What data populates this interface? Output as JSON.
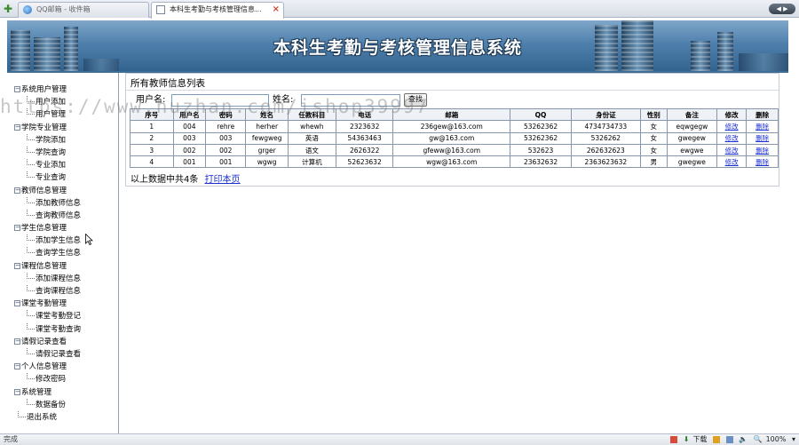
{
  "browser": {
    "tabs": [
      {
        "label": "QQ邮箱 - 收件箱",
        "active": false
      },
      {
        "label": "本科生考勤与考核管理信息...",
        "active": true
      }
    ],
    "new_tab_icon": "plus-icon",
    "status_text": "完成",
    "status_download": "下载",
    "zoom": "100%"
  },
  "header": {
    "title": "本科生考勤与考核管理信息系统"
  },
  "sidebar": {
    "groups": [
      {
        "label": "系统用户管理",
        "items": [
          "用户添加",
          "用户管理"
        ]
      },
      {
        "label": "学院专业管理",
        "items": [
          "学院添加",
          "学院查询",
          "专业添加",
          "专业查询"
        ]
      },
      {
        "label": "教师信息管理",
        "items": [
          "添加教师信息",
          "查询教师信息"
        ]
      },
      {
        "label": "学生信息管理",
        "items": [
          "添加学生信息",
          "查询学生信息"
        ]
      },
      {
        "label": "课程信息管理",
        "items": [
          "添加课程信息",
          "查询课程信息"
        ]
      },
      {
        "label": "课堂考勤管理",
        "items": [
          "课堂考勤登记",
          "课堂考勤查询"
        ]
      },
      {
        "label": "请假记录查看",
        "items": [
          "请假记录查看"
        ]
      },
      {
        "label": "个人信息管理",
        "items": [
          "修改密码"
        ]
      },
      {
        "label": "系统管理",
        "items": [
          "数据备份"
        ]
      }
    ],
    "logout": "退出系统"
  },
  "main": {
    "title": "所有教师信息列表",
    "search": {
      "username_label": "用户名:",
      "username_value": "",
      "name_label": "姓名:",
      "name_value": "",
      "button": "查找"
    },
    "table": {
      "headers": [
        "序号",
        "用户名",
        "密码",
        "姓名",
        "任教科目",
        "电话",
        "邮箱",
        "QQ",
        "身份证",
        "性别",
        "备注",
        "修改",
        "删除"
      ],
      "rows": [
        [
          "1",
          "004",
          "rehre",
          "herher",
          "whewh",
          "2323632",
          "236gew@163.com",
          "53262362",
          "4734734733",
          "女",
          "eqwgegw",
          "修改",
          "删除"
        ],
        [
          "2",
          "003",
          "003",
          "fewgweg",
          "英语",
          "54363463",
          "gw@163.com",
          "53262362",
          "5326262",
          "女",
          "gwegew",
          "修改",
          "删除"
        ],
        [
          "3",
          "002",
          "002",
          "grger",
          "语文",
          "2626322",
          "gfeww@163.com",
          "532623",
          "262632623",
          "女",
          "ewgwe",
          "修改",
          "删除"
        ],
        [
          "4",
          "001",
          "001",
          "wgwg",
          "计算机",
          "52623632",
          "wgw@163.com",
          "23632632",
          "2363623632",
          "男",
          "gwegwe",
          "修改",
          "删除"
        ]
      ]
    },
    "summary": "以上数据中共4条",
    "print_link": "打印本页"
  },
  "watermark": "https://www.huzhan.com/ishop39997",
  "colors": {
    "banner_blue": "#4f80ad",
    "link_blue": "#1a2fd6",
    "table_border": "#8796a8"
  }
}
